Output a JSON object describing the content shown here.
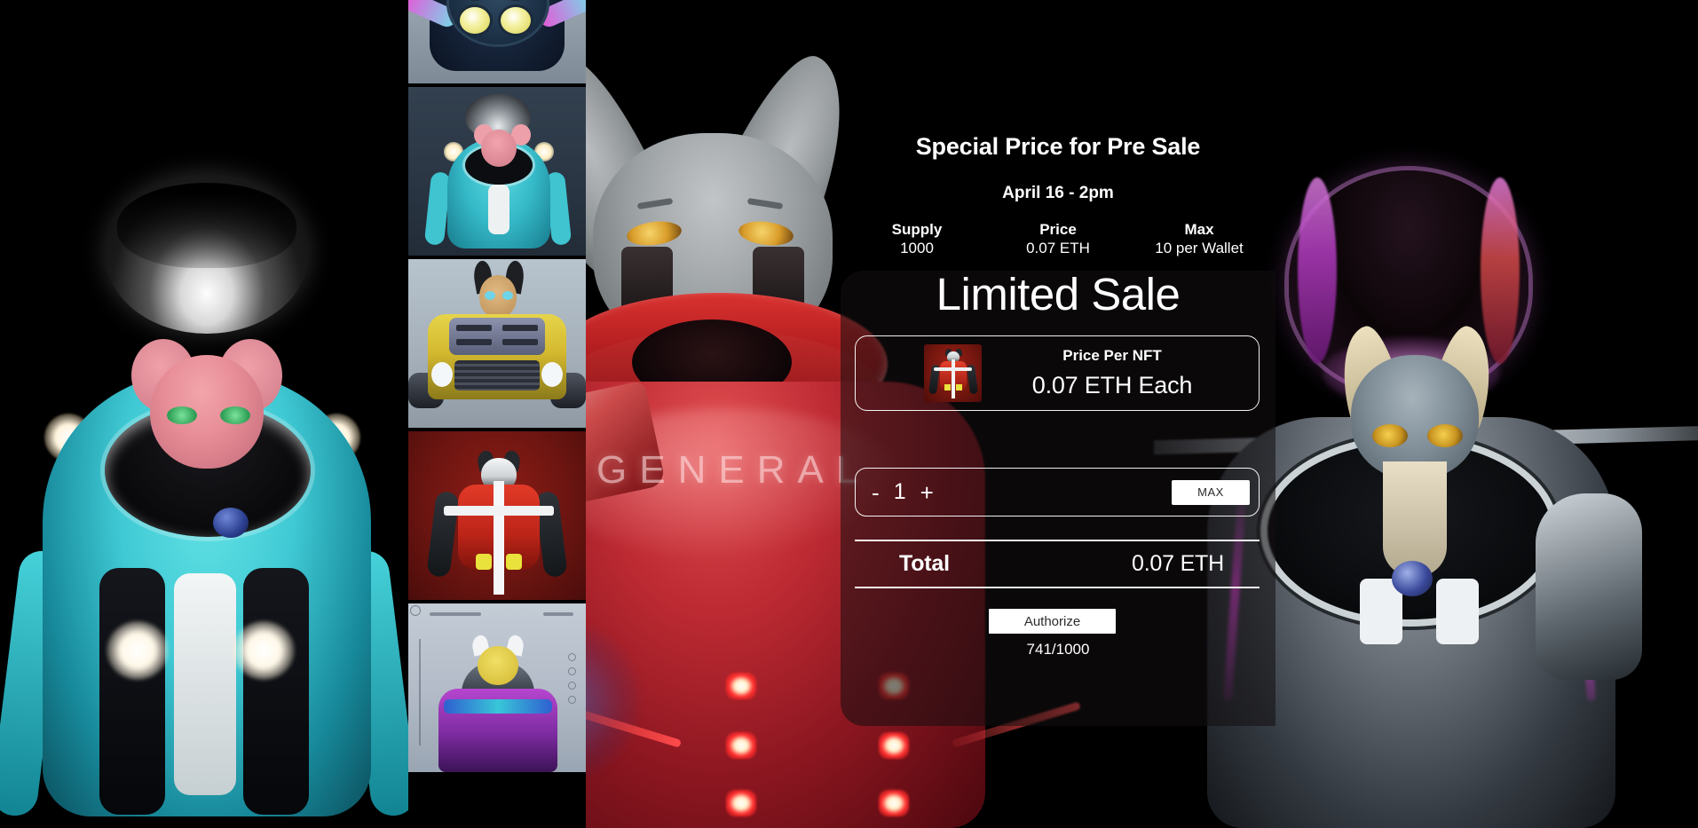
{
  "promo": {
    "title": "Special Price for Pre Sale",
    "date": "April 16 - 2pm"
  },
  "stats": [
    {
      "key": "Supply",
      "value": "1000"
    },
    {
      "key": "Price",
      "value": "0.07 ETH"
    },
    {
      "key": "Max",
      "value": "10 per Wallet"
    }
  ],
  "sale": {
    "heading": "Limited Sale",
    "price_card": {
      "label": "Price Per NFT",
      "value": "0.07 ETH Each",
      "avatar_icon": "nft-thumbnail-red-mech"
    },
    "quantity": {
      "decrement_label": "-",
      "value": "1",
      "increment_label": "+",
      "max_label": "MAX"
    },
    "total": {
      "label": "Total",
      "value": "0.07 ETH"
    },
    "authorize_label": "Authorize",
    "minted_counter": "741/1000"
  },
  "gallery": {
    "thumbnails": [
      {
        "name": "thumb-navy-quad-lamp-mech"
      },
      {
        "name": "thumb-cyan-mech-pink-mouse"
      },
      {
        "name": "thumb-yellow-car-mech-tan-cat"
      },
      {
        "name": "thumb-red-white-mech"
      },
      {
        "name": "thumb-purple-pod-yellow-cat"
      }
    ]
  },
  "backdrop": {
    "center_wordmark": "GENERAL",
    "left_scene": "cyan-mech-pink-mouse",
    "center_scene": "grey-sphynx-red-general-mech",
    "right_scene": "grey-cat-magenta-canopy-mech"
  },
  "colors": {
    "background": "#000000",
    "panel_overlay": "rgba(18,14,16,0.55)",
    "button_fill": "#ffffff",
    "button_text": "#2c2c2c",
    "text": "#ffffff",
    "accent_red": "#bb2418",
    "accent_cyan": "#35b9c8",
    "accent_magenta": "#e24de0"
  }
}
